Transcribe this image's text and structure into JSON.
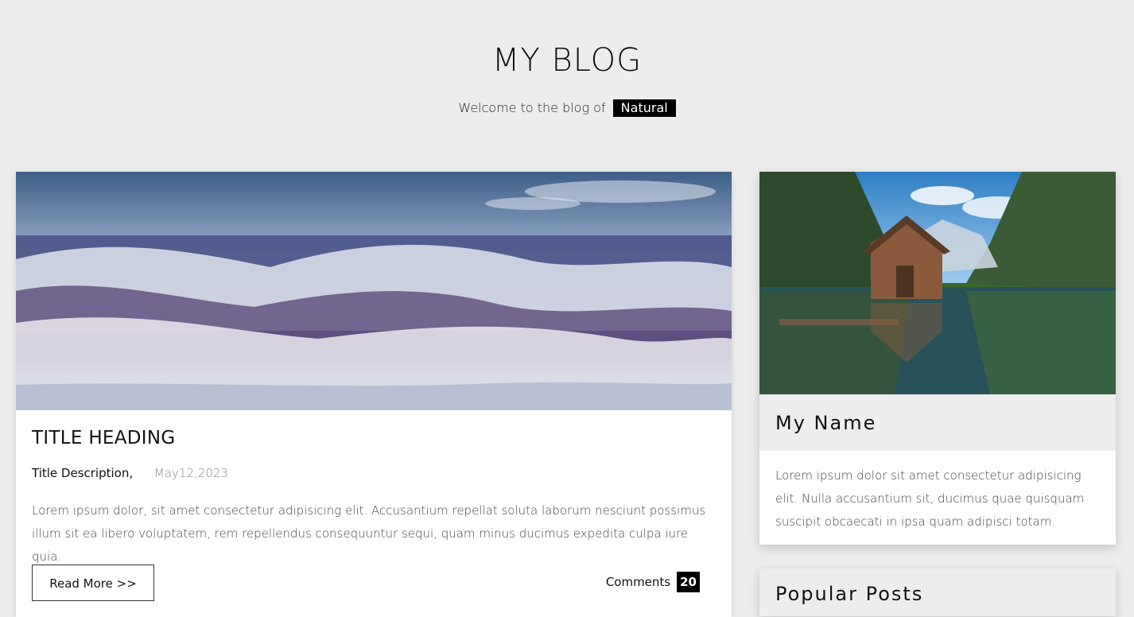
{
  "header": {
    "title": "MY BLOG",
    "tagline": "Welcome to the blog of",
    "tag": "Natural"
  },
  "post": {
    "title": "TITLE HEADING",
    "description": "Title Description,",
    "date": "May12,2023",
    "excerpt": "Lorem ipsum dolor, sit amet consectetur adipisicing elit. Accusantium repellat soluta laborum nesciunt possimus illum sit ea libero voluptatem, rem repellendus consequuntur sequi, quam minus ducimus expedita culpa iure quia.",
    "read_more": "Read More >>",
    "comments_label": "Comments",
    "comments_count": "20"
  },
  "sidebar": {
    "name": "My Name",
    "bio": "Lorem ipsum dolor sit amet consectetur adipisicing elit. Nulla accusantium sit, ducimus quae quisquam suscipit obcaecati in ipsa quam adipisci totam.",
    "popular_title": "Popular Posts"
  }
}
